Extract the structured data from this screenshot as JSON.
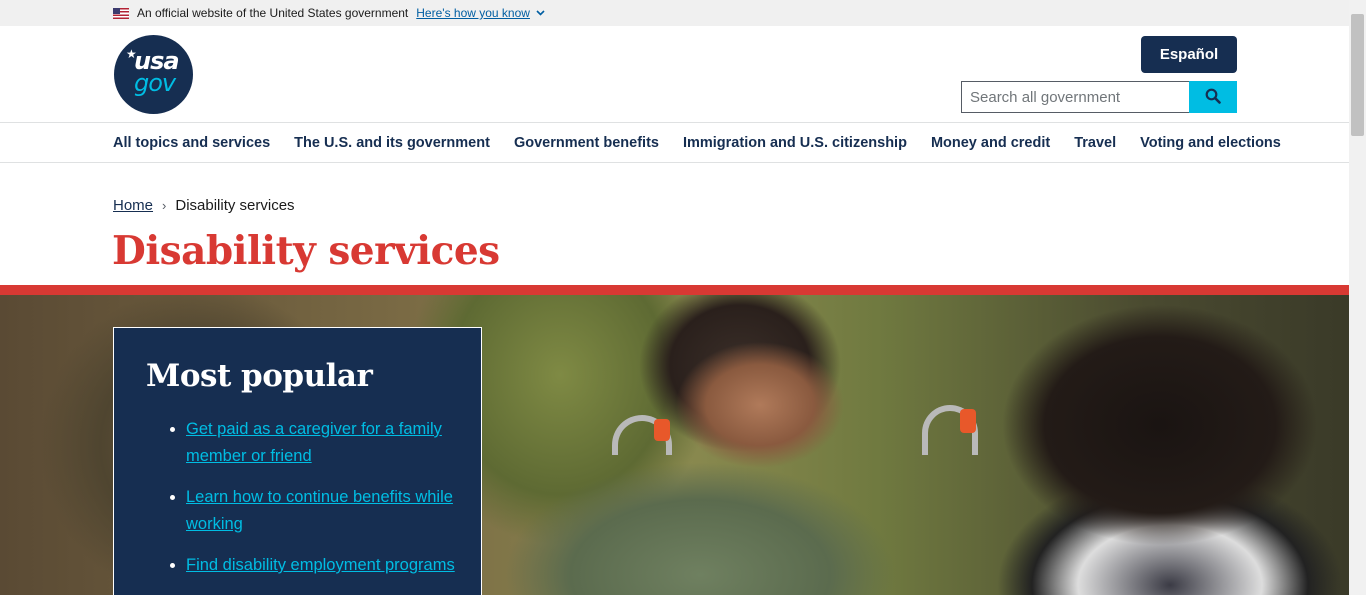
{
  "gov_banner": {
    "text": "An official website of the United States government",
    "link": "Here's how you know"
  },
  "header": {
    "logo_top": "usa",
    "logo_bottom": "gov",
    "language_button": "Español",
    "search_placeholder": "Search all government"
  },
  "nav": {
    "items": [
      "All topics and services",
      "The U.S. and its government",
      "Government benefits",
      "Immigration and U.S. citizenship",
      "Money and credit",
      "Travel",
      "Voting and elections"
    ]
  },
  "breadcrumb": {
    "home": "Home",
    "current": "Disability services"
  },
  "page": {
    "title": "Disability services"
  },
  "popular": {
    "heading": "Most popular",
    "links": [
      "Get paid as a caregiver for a family member or friend",
      "Learn how to continue benefits while working",
      "Find disability employment programs"
    ]
  },
  "colors": {
    "navy": "#162e51",
    "accent_red": "#d83933",
    "cyan": "#00bde3"
  }
}
